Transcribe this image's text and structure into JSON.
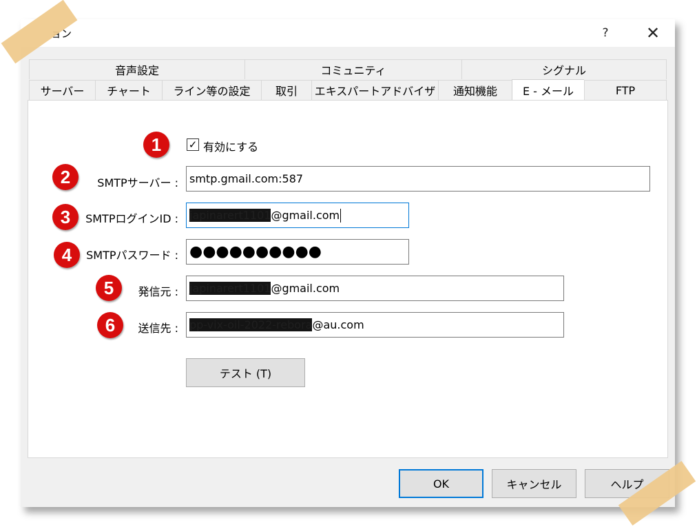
{
  "window": {
    "title": "ョン",
    "help_glyph": "?",
    "close_glyph": "✕"
  },
  "tabs": {
    "row1": [
      "音声設定",
      "コミュニティ",
      "シグナル"
    ],
    "row2": [
      "サーバー",
      "チャート",
      "ライン等の設定",
      "取引",
      "エキスパートアドバイザ",
      "通知機能",
      "E - メール",
      "FTP"
    ],
    "active": "E - メール"
  },
  "form": {
    "enable": {
      "badge": "1",
      "checked": true,
      "check_glyph": "✓",
      "label": "有効にする"
    },
    "smtp_server": {
      "badge": "2",
      "label": "SMTPサーバー :",
      "value": "smtp.gmail.com:587"
    },
    "login_id": {
      "badge": "3",
      "label": "SMTPログインID :",
      "value_hidden": "japinarert1101",
      "value_suffix": "@gmail.com"
    },
    "password": {
      "badge": "4",
      "label": "SMTPパスワード :",
      "value": "●●●●●●●●●●"
    },
    "from": {
      "badge": "5",
      "label": "発信元 :",
      "value_hidden": "japinarert1101",
      "value_suffix": "@gmail.com"
    },
    "to": {
      "badge": "6",
      "label": "送信先 :",
      "value_hidden": "pp-vix-oil-2022-rebora",
      "value_suffix": "@au.com"
    },
    "test_button": "テスト (T)"
  },
  "buttons": {
    "ok": "OK",
    "cancel": "キャンセル",
    "help": "ヘルプ"
  },
  "colors": {
    "badge": "#d80d0d",
    "focus": "#0078d7",
    "tape": "#efc98a"
  }
}
